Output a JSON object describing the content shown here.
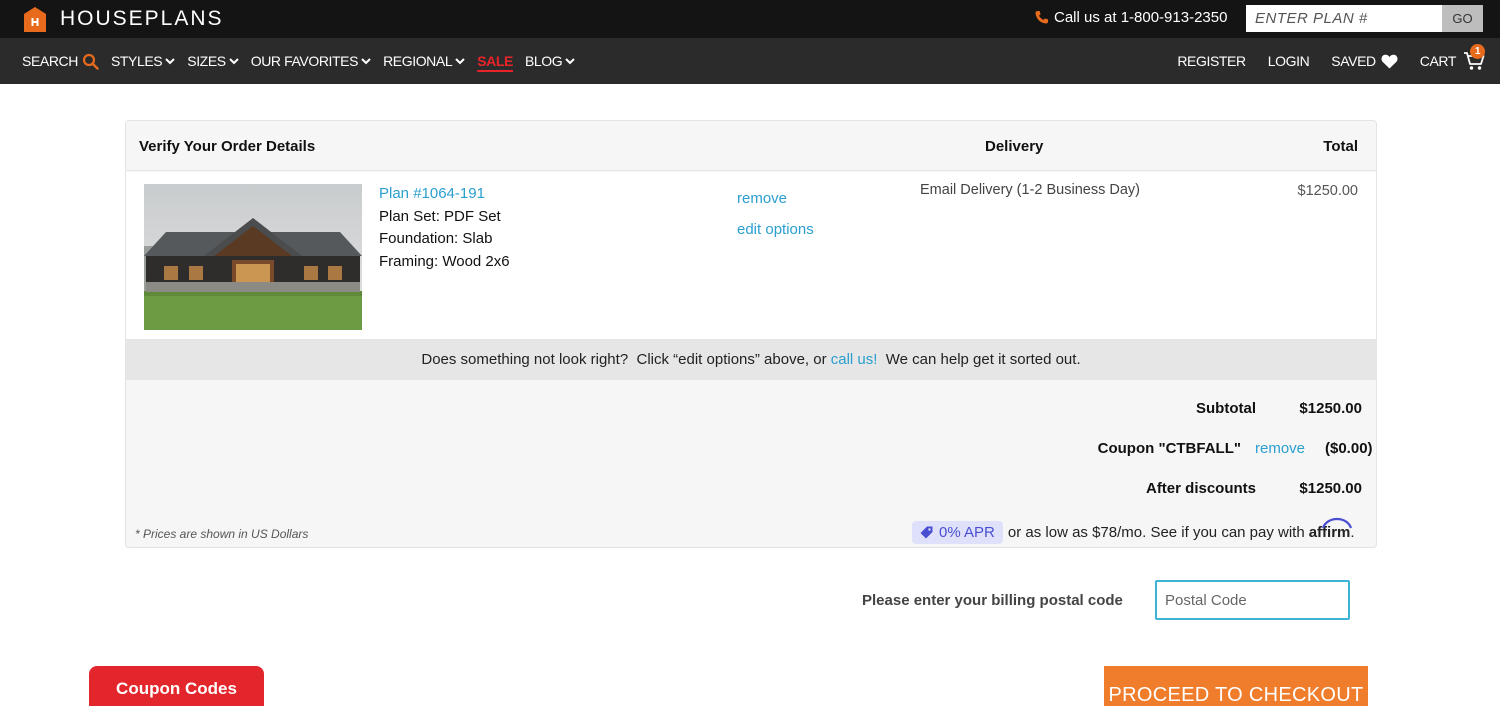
{
  "brand": {
    "name": "HOUSEPLANS",
    "accent": "#e86a1c"
  },
  "header": {
    "callus": "Call us at 1-800-913-2350",
    "plan_search_placeholder": "ENTER PLAN #",
    "go_label": "GO"
  },
  "nav": {
    "left": [
      {
        "label": "SEARCH",
        "icon": "search-icon"
      },
      {
        "label": "STYLES",
        "icon": "chevron-down-icon"
      },
      {
        "label": "SIZES",
        "icon": "chevron-down-icon"
      },
      {
        "label": "OUR FAVORITES",
        "icon": "chevron-down-icon"
      },
      {
        "label": "REGIONAL",
        "icon": "chevron-down-icon"
      },
      {
        "label": "SALE",
        "color": "#e8232a"
      },
      {
        "label": "BLOG",
        "icon": "chevron-down-icon"
      }
    ],
    "right": [
      {
        "label": "REGISTER"
      },
      {
        "label": "LOGIN"
      },
      {
        "label": "SAVED",
        "icon": "heart-icon"
      },
      {
        "label": "CART",
        "icon": "cart-icon",
        "badge": "1"
      }
    ]
  },
  "order": {
    "title": "Verify Your Order Details",
    "col_delivery": "Delivery",
    "col_total": "Total",
    "item": {
      "plan": "Plan #1064-191",
      "plan_set": "Plan Set: PDF Set",
      "foundation": "Foundation: Slab",
      "framing": "Framing: Wood 2x6",
      "remove": "remove",
      "edit": "edit options",
      "delivery": "Email Delivery (1-2 Business Day)",
      "price": "$1250.00"
    },
    "help": {
      "before": "Does something not look right?  Click “edit options” above, or ",
      "link": "call us!",
      "after": "  We can help get it sorted out."
    },
    "subtotal_label": "Subtotal",
    "subtotal_value": "$1250.00",
    "coupon_label": "Coupon \"CTBFALL\"",
    "coupon_remove": "remove",
    "coupon_value": "($0.00)",
    "after_label": "After discounts",
    "after_value": "$1250.00",
    "note": "* Prices are shown in US Dollars",
    "affirm": {
      "apr": "0% APR",
      "text": "or as low as $78/mo. See if you can pay with",
      "logo": "affirm",
      "period": "."
    }
  },
  "billing": {
    "label": "Please enter your billing postal code",
    "placeholder": "Postal Code"
  },
  "buttons": {
    "coupon": "Coupon Codes",
    "checkout": "PROCEED TO CHECKOUT"
  },
  "colors": {
    "link": "#2a9fd0",
    "checkout": "#ef7d2c",
    "coupon": "#e3262b",
    "input_focus": "#3fb3d6"
  }
}
